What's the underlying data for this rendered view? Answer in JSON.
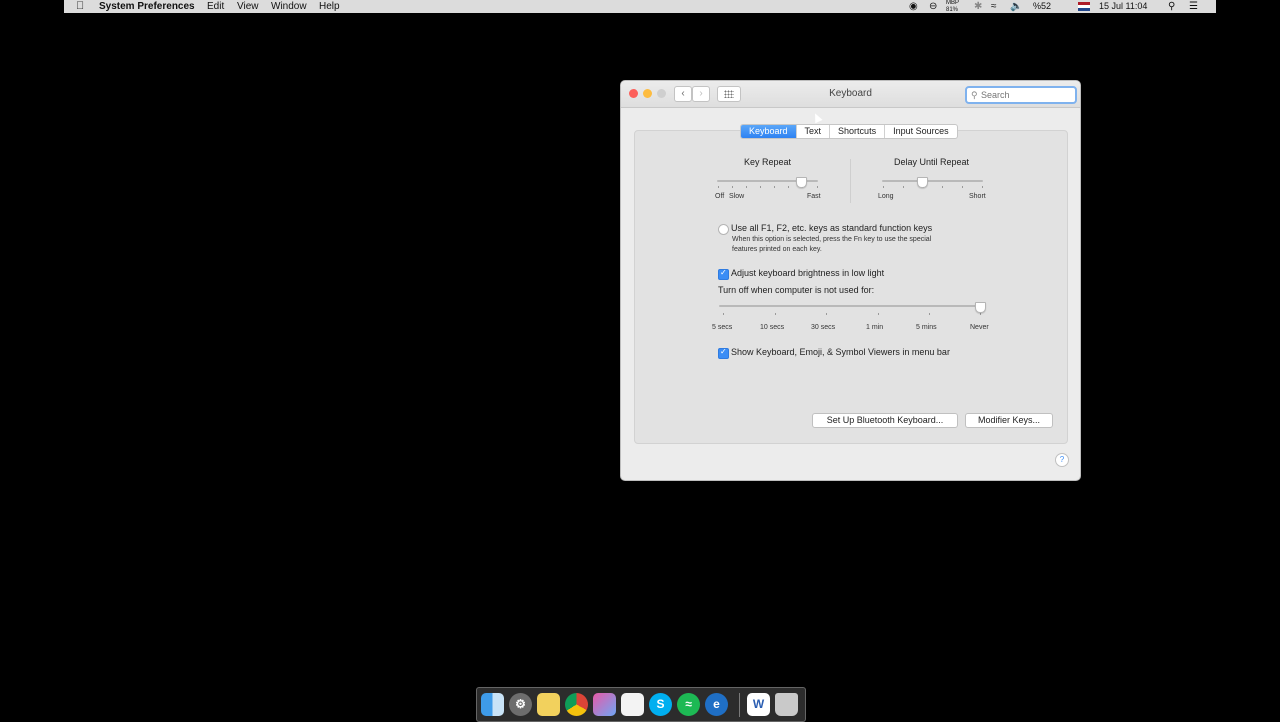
{
  "menubar": {
    "app_name": "System Preferences",
    "items": [
      "Edit",
      "View",
      "Window",
      "Help"
    ],
    "battery_top": "MBP",
    "battery_percent": "81%",
    "wifi_percent": "%52",
    "datetime": "15 Jul  11:04"
  },
  "window": {
    "title": "Keyboard",
    "search_placeholder": "Search",
    "tabs": [
      "Keyboard",
      "Text",
      "Shortcuts",
      "Input Sources"
    ],
    "selected_tab": "Keyboard",
    "key_repeat": {
      "title": "Key Repeat",
      "min_label": "Off",
      "slow_label": "Slow",
      "max_label": "Fast",
      "value_fraction": 0.83
    },
    "delay_until_repeat": {
      "title": "Delay Until Repeat",
      "min_label": "Long",
      "max_label": "Short",
      "value_fraction": 0.4
    },
    "fn_keys": {
      "label": "Use all F1, F2, etc. keys as standard function keys",
      "description_line1": "When this option is selected, press the Fn key to use the special",
      "description_line2": "features printed on each key.",
      "checked": false
    },
    "brightness": {
      "label": "Adjust keyboard brightness in low light",
      "checked": true
    },
    "turn_off": {
      "label": "Turn off when computer is not used for:",
      "ticks": [
        "5 secs",
        "10 secs",
        "30 secs",
        "1 min",
        "5 mins",
        "Never"
      ],
      "value": "Never"
    },
    "viewers": {
      "label": "Show Keyboard, Emoji, & Symbol Viewers in menu bar",
      "checked": true
    },
    "buttons": {
      "bluetooth": "Set Up Bluetooth Keyboard...",
      "modifier": "Modifier Keys..."
    },
    "help": "?"
  },
  "dock": {
    "apps": [
      "finder",
      "system-preferences",
      "notes",
      "chrome",
      "launchpad",
      "textedit",
      "skype",
      "spotify",
      "edge",
      "word",
      "trash"
    ]
  },
  "colors": {
    "accent": "#2e82f2",
    "menubar_bg": "#dcdcdc",
    "window_bg": "#ececec"
  }
}
